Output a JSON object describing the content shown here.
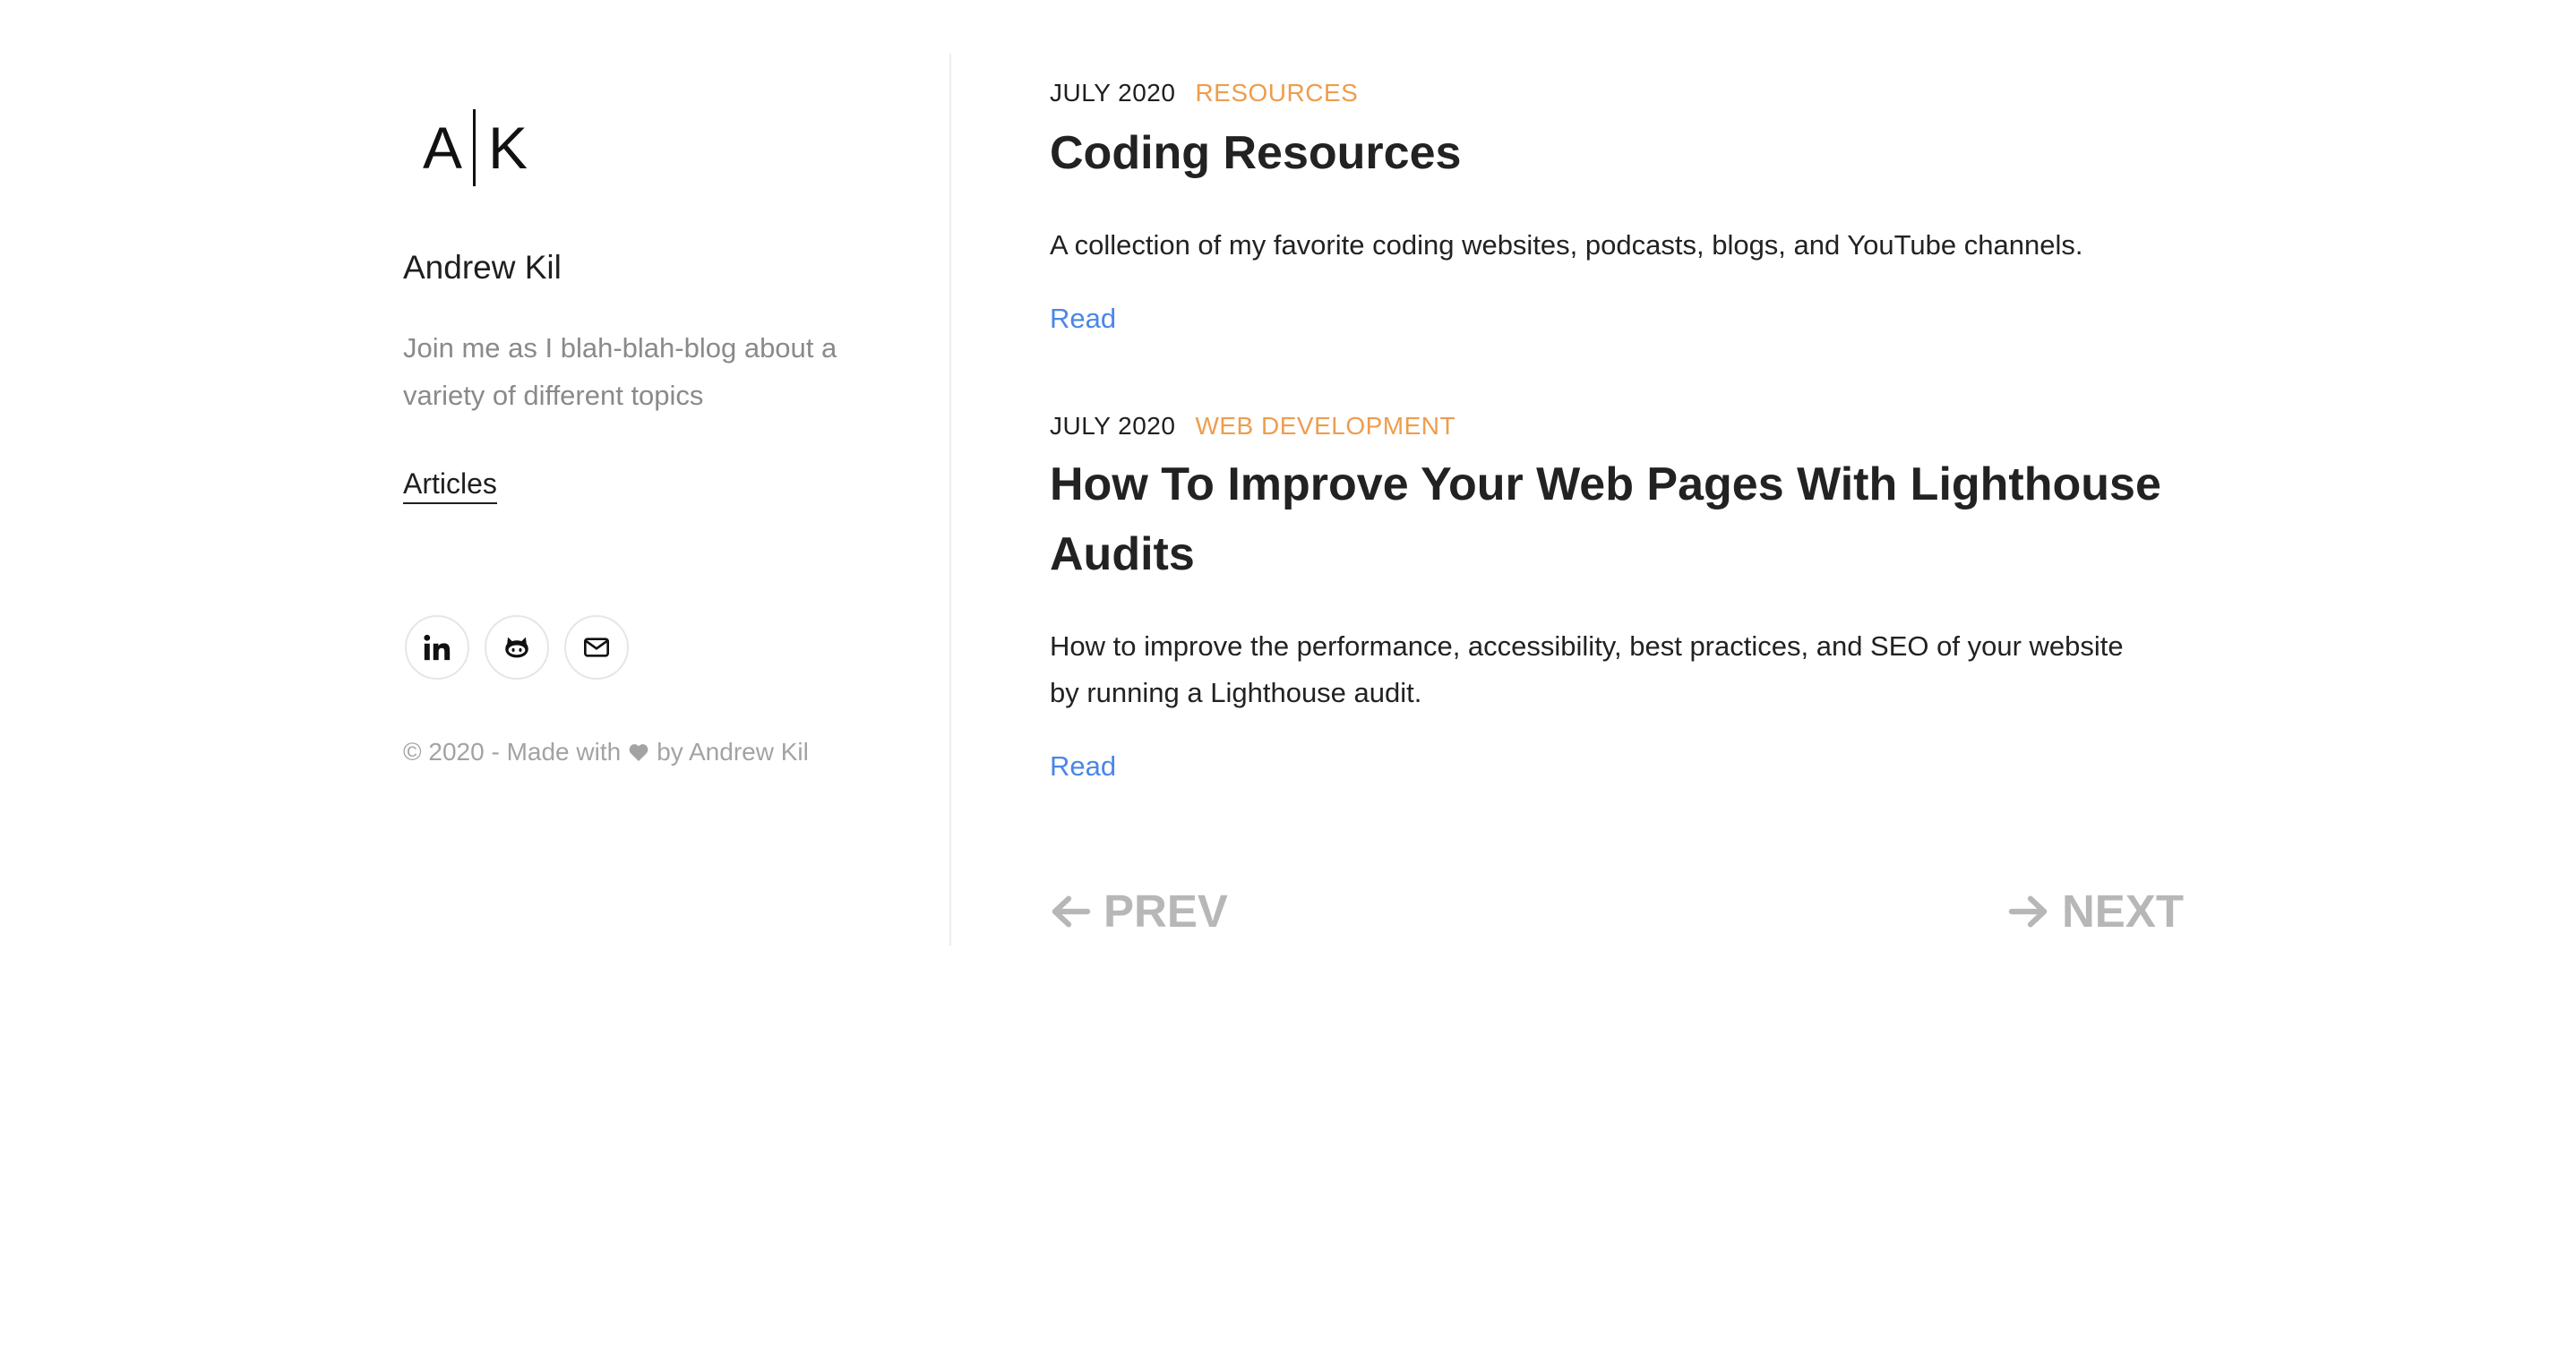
{
  "sidebar": {
    "logo_left": "A",
    "logo_right": "K",
    "name": "Andrew Kil",
    "description": "Join me as I blah-blah-blog about a variety of different topics",
    "nav": {
      "articles_label": "Articles"
    },
    "socials": [
      {
        "icon": "linkedin-icon"
      },
      {
        "icon": "github-icon"
      },
      {
        "icon": "email-icon"
      }
    ],
    "copyright_before": "© 2020 - Made with",
    "copyright_after": "by Andrew Kil"
  },
  "posts": [
    {
      "date": "JULY 2020",
      "category": "RESOURCES",
      "title": "Coding Resources",
      "excerpt": "A collection of my favorite coding websites, podcasts, blogs, and YouTube channels.",
      "read_label": "Read"
    },
    {
      "date": "JULY 2020",
      "category": "WEB DEVELOPMENT",
      "title": "How To Improve Your Web Pages With Lighthouse Audits",
      "excerpt": "How to improve the performance, accessibility, best practices, and SEO of your website by running a Lighthouse audit.",
      "read_label": "Read"
    }
  ],
  "pagination": {
    "prev_label": "PREV",
    "next_label": "NEXT"
  },
  "colors": {
    "accent_category": "#ee9d4d",
    "link": "#4a86e8",
    "muted": "#a3a3a3",
    "pager": "#b7b7b7"
  }
}
